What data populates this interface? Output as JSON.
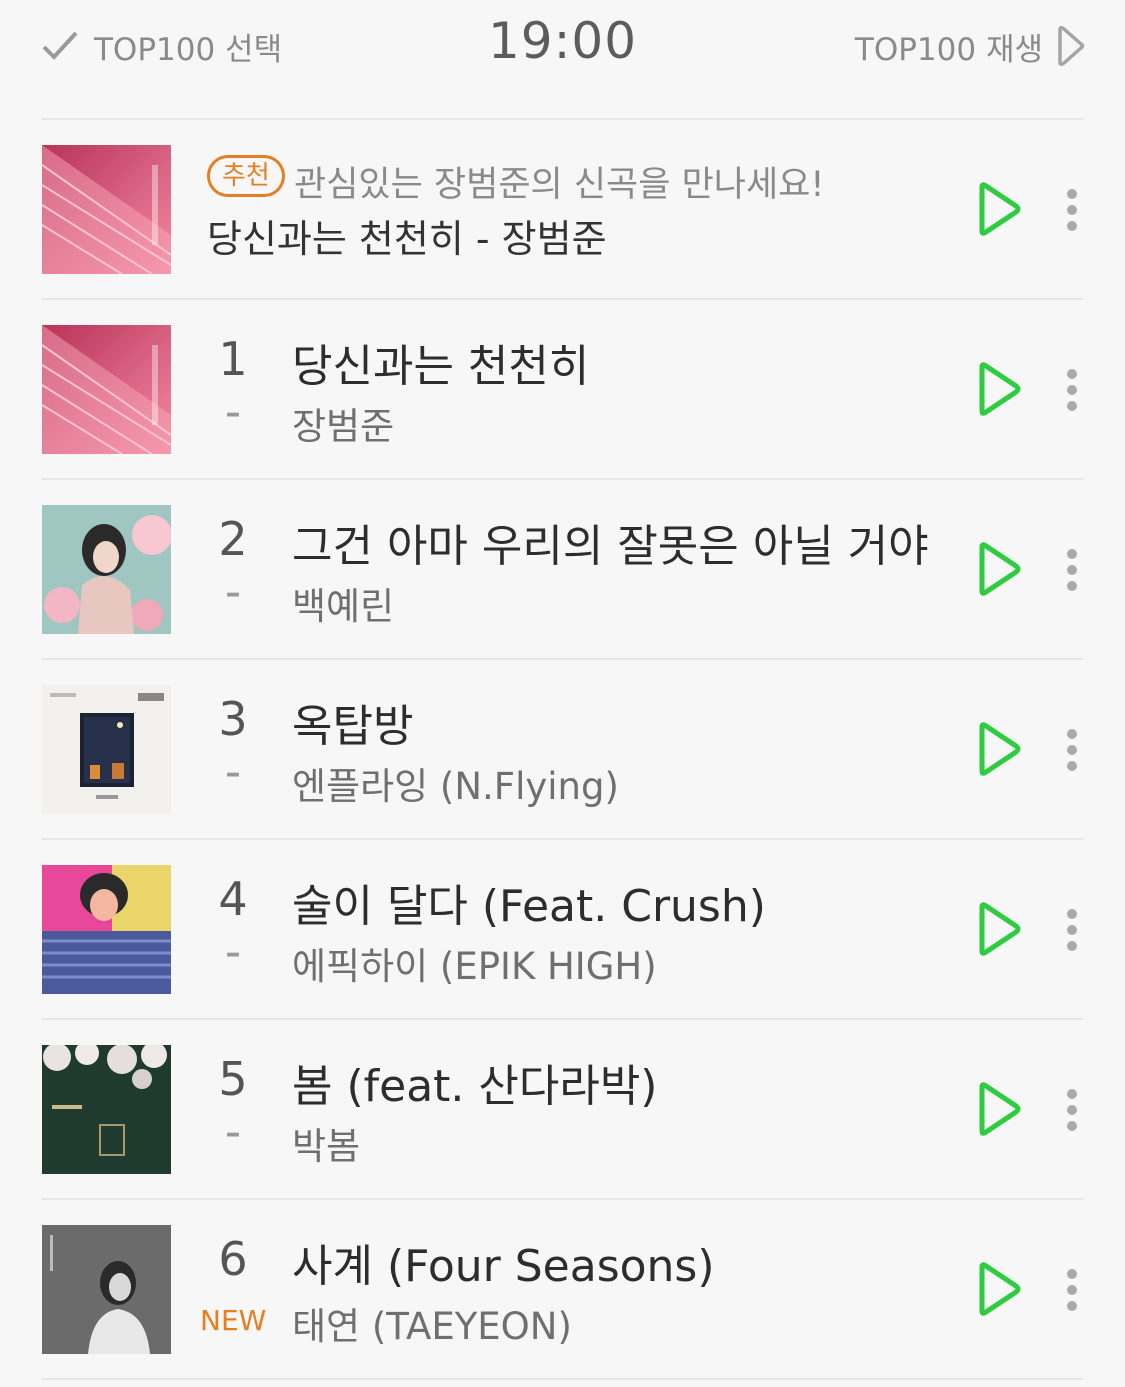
{
  "header": {
    "select_label": "TOP100 선택",
    "time": "19:00",
    "play_all_label": "TOP100 재생"
  },
  "recommendation": {
    "badge": "추천",
    "text": "관심있는 장범준의 신곡을 만나세요!",
    "song": "당신과는 천천히 - 장범준"
  },
  "songs": [
    {
      "rank": "1",
      "change": "–",
      "title": "당신과는 천천히",
      "artist": "장범준"
    },
    {
      "rank": "2",
      "change": "–",
      "title": "그건 아마 우리의 잘못은 아닐 거야",
      "artist": "백예린"
    },
    {
      "rank": "3",
      "change": "–",
      "title": "옥탑방",
      "artist": "엔플라잉 (N.Flying)"
    },
    {
      "rank": "4",
      "change": "–",
      "title": "술이 달다 (Feat. Crush)",
      "artist": "에픽하이 (EPIK HIGH)"
    },
    {
      "rank": "5",
      "change": "–",
      "title": "봄 (feat. 산다라박)",
      "artist": "박봄"
    },
    {
      "rank": "6",
      "change": "NEW",
      "title": "사계 (Four Seasons)",
      "artist": "태연 (TAEYEON)"
    }
  ],
  "colors": {
    "accent_green": "#2ecc40",
    "badge_orange": "#e67e22"
  },
  "icons": {
    "check": "check-icon",
    "play": "play-icon",
    "more": "more-vertical-icon"
  }
}
